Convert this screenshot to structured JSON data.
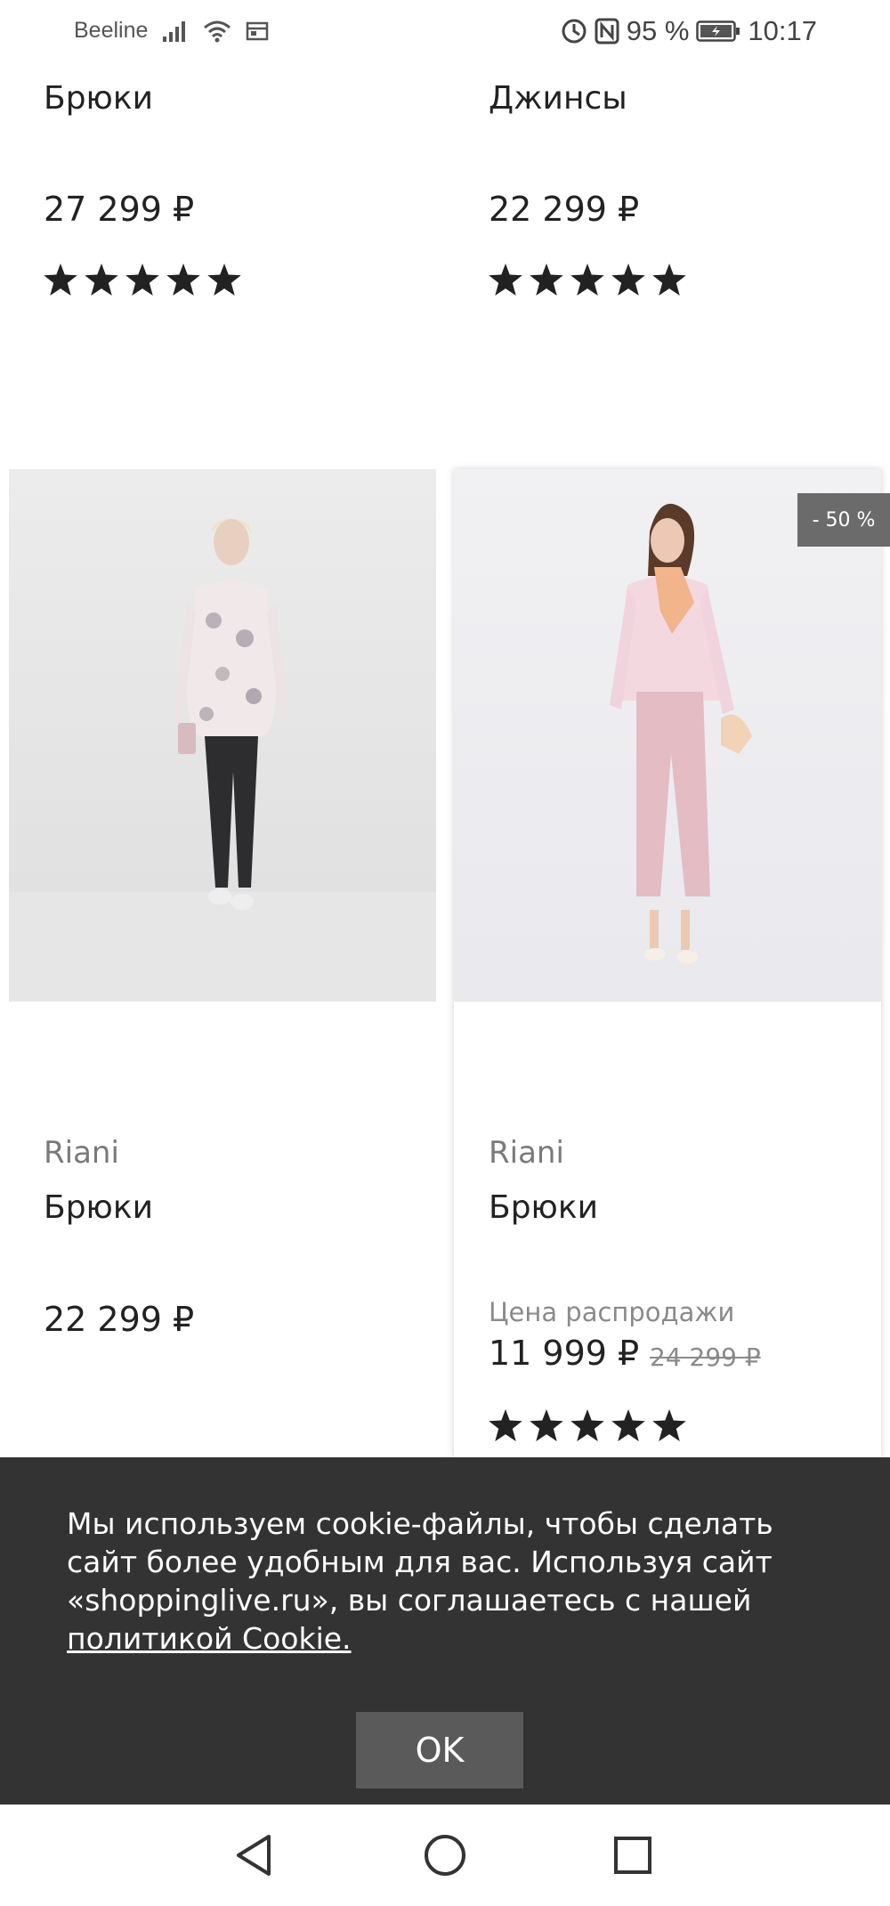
{
  "status_bar": {
    "carrier": "Beeline",
    "battery_percent": "95 %",
    "time": "10:17",
    "icons": [
      "signal-icon",
      "wifi-icon",
      "sim-card-icon",
      "data-saver-icon",
      "nfc-icon",
      "battery-icon"
    ]
  },
  "products_top": [
    {
      "name": "Брюки",
      "price": "27 299 ₽",
      "rating": 5
    },
    {
      "name": "Джинсы",
      "price": "22 299 ₽",
      "rating": 5
    }
  ],
  "products_bottom": [
    {
      "brand": "Riani",
      "name": "Брюки",
      "price": "22 299 ₽"
    },
    {
      "brand": "Riani",
      "name": "Брюки",
      "sale_label": "Цена распродажи",
      "price": "11 999 ₽",
      "old_price": "24 299 ₽",
      "discount": "- 50 %",
      "rating": 5
    }
  ],
  "cookie": {
    "text": "Мы используем cookie-файлы, чтобы сделать сайт более удобным для вас. Используя сайт «shoppinglive.ru», вы соглашаетесь с нашей ",
    "link_text": "политикой Cookie.",
    "ok_label": "OK"
  },
  "nav": {
    "icons": [
      "back-icon",
      "home-icon",
      "recents-icon"
    ]
  },
  "colors": {
    "banner_bg": "#333333",
    "ok_button_bg": "#5a5a5a",
    "badge_bg": "#6b6b6b",
    "text_dark": "#222222",
    "text_muted": "#7a7a7a"
  }
}
